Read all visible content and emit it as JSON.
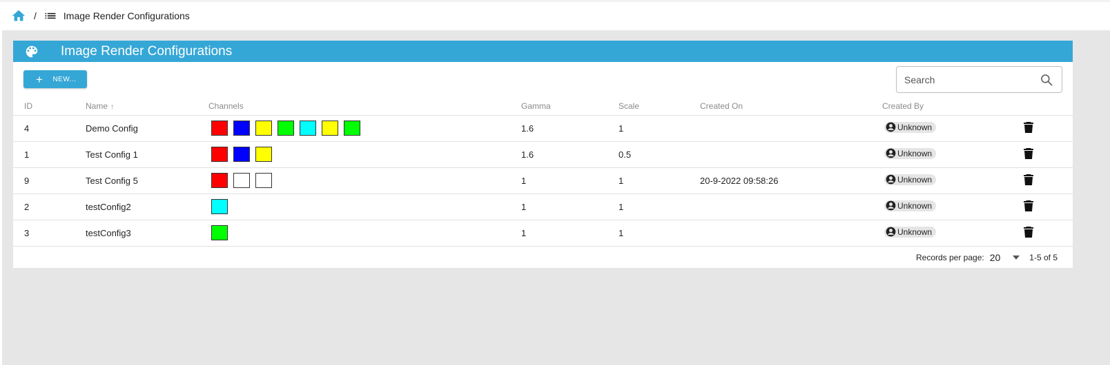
{
  "breadcrumb": {
    "home_icon": "home-icon",
    "separator": "/",
    "list_icon": "list-icon",
    "title": "Image Render Configurations"
  },
  "panel": {
    "icon": "palette-icon",
    "title": "Image Render Configurations",
    "header_color": "#35a7d6"
  },
  "toolbar": {
    "new_label": "NEW...",
    "search_placeholder": "Search"
  },
  "table": {
    "columns": [
      "ID",
      "Name",
      "Channels",
      "Gamma",
      "Scale",
      "Created On",
      "Created By"
    ],
    "sort_column": "Name",
    "sort_direction": "ascending",
    "rows": [
      {
        "id": "4",
        "name": "Demo Config",
        "channels": [
          "#ff0000",
          "#0000ff",
          "#ffff00",
          "#00ff00",
          "#00ffff",
          "#ffff00",
          "#00ff00"
        ],
        "gamma": "1.6",
        "scale": "1",
        "created_on": "",
        "created_by": "Unknown"
      },
      {
        "id": "1",
        "name": "Test Config 1",
        "channels": [
          "#ff0000",
          "#0000ff",
          "#ffff00"
        ],
        "gamma": "1.6",
        "scale": "0.5",
        "created_on": "",
        "created_by": "Unknown"
      },
      {
        "id": "9",
        "name": "Test Config 5",
        "channels": [
          "#ff0000",
          "#ffffff",
          "#ffffff"
        ],
        "gamma": "1",
        "scale": "1",
        "created_on": "20-9-2022 09:58:26",
        "created_by": "Unknown"
      },
      {
        "id": "2",
        "name": "testConfig2",
        "channels": [
          "#00ffff"
        ],
        "gamma": "1",
        "scale": "1",
        "created_on": "",
        "created_by": "Unknown"
      },
      {
        "id": "3",
        "name": "testConfig3",
        "channels": [
          "#00ff00"
        ],
        "gamma": "1",
        "scale": "1",
        "created_on": "",
        "created_by": "Unknown"
      }
    ]
  },
  "footer": {
    "records_label": "Records per page:",
    "records_value": "20",
    "range": "1-5 of 5"
  }
}
